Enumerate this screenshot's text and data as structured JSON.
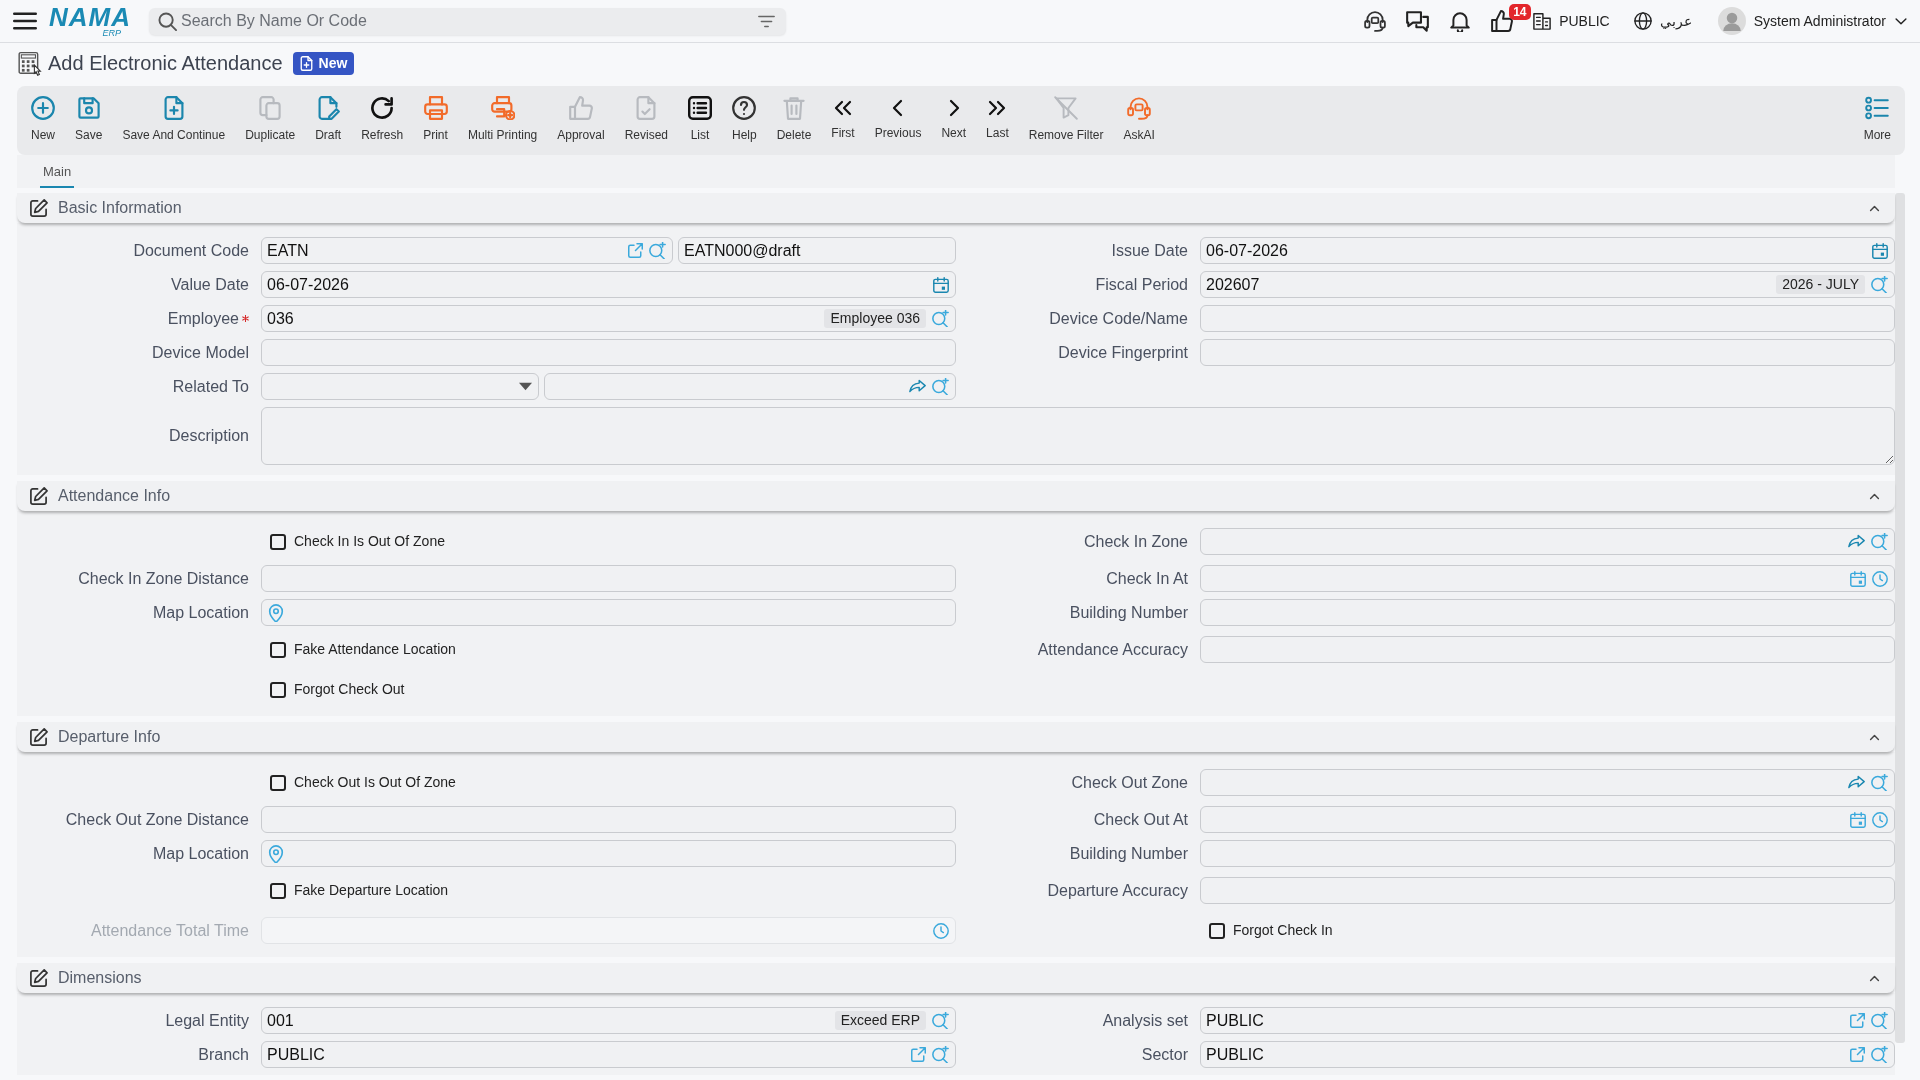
{
  "topbar": {
    "logo": {
      "name": "NAMA",
      "sub": "ERP"
    },
    "search": {
      "placeholder": "Search By Name Or Code"
    },
    "notification_count": "14",
    "company": "PUBLIC",
    "language": "عربي",
    "user": "System Administrator"
  },
  "page": {
    "title": "Add Electronic Attendance",
    "status": "New"
  },
  "toolbar": [
    {
      "label": "New",
      "disabled": false
    },
    {
      "label": "Save",
      "disabled": false
    },
    {
      "label": "Save And Continue",
      "disabled": false
    },
    {
      "label": "Duplicate",
      "disabled": true
    },
    {
      "label": "Draft",
      "disabled": false
    },
    {
      "label": "Refresh",
      "disabled": false
    },
    {
      "label": "Print",
      "disabled": false
    },
    {
      "label": "Multi Printing",
      "disabled": false
    },
    {
      "label": "Approval",
      "disabled": true
    },
    {
      "label": "Revised",
      "disabled": true
    },
    {
      "label": "List",
      "disabled": false
    },
    {
      "label": "Help",
      "disabled": false
    },
    {
      "label": "Delete",
      "disabled": true
    },
    {
      "label": "First",
      "disabled": false
    },
    {
      "label": "Previous",
      "disabled": false
    },
    {
      "label": "Next",
      "disabled": false
    },
    {
      "label": "Last",
      "disabled": false
    },
    {
      "label": "Remove Filter",
      "disabled": true
    },
    {
      "label": "AskAI",
      "disabled": false
    }
  ],
  "toolbar_more": {
    "label": "More"
  },
  "tabs": [
    {
      "label": "Main",
      "selected": true
    }
  ],
  "sections": [
    {
      "title": "Basic Information",
      "expanded": true,
      "rows": [
        {
          "left": {
            "kind": "field",
            "label": "Document Code",
            "required": false,
            "disabled": false,
            "inputs": [
              {
                "kind": "link",
                "value": "EATN"
              },
              {
                "kind": "text",
                "value": "EATN000@draft"
              }
            ]
          },
          "right": {
            "kind": "field",
            "label": "Issue Date",
            "required": false,
            "disabled": false,
            "inputs": [
              {
                "kind": "date",
                "value": "06-07-2026"
              }
            ]
          }
        },
        {
          "left": {
            "kind": "field",
            "label": "Value Date",
            "required": false,
            "disabled": false,
            "inputs": [
              {
                "kind": "date",
                "value": "06-07-2026"
              }
            ]
          },
          "right": {
            "kind": "field",
            "label": "Fiscal Period",
            "required": false,
            "disabled": false,
            "inputs": [
              {
                "kind": "lookup",
                "value": "202607",
                "tag": "2026 - JULY"
              }
            ]
          }
        },
        {
          "left": {
            "kind": "field",
            "label": "Employee",
            "required": true,
            "disabled": false,
            "inputs": [
              {
                "kind": "lookup",
                "value": "036",
                "tag": "Employee 036"
              }
            ]
          },
          "right": {
            "kind": "field",
            "label": "Device Code/Name",
            "required": false,
            "disabled": false,
            "inputs": [
              {
                "kind": "text"
              }
            ]
          }
        },
        {
          "left": {
            "kind": "field",
            "label": "Device Model",
            "required": false,
            "disabled": false,
            "inputs": [
              {
                "kind": "text"
              }
            ]
          },
          "right": {
            "kind": "field",
            "label": "Device Fingerprint",
            "required": false,
            "disabled": false,
            "inputs": [
              {
                "kind": "text"
              }
            ]
          }
        },
        {
          "left": {
            "kind": "field",
            "label": "Related To",
            "required": false,
            "disabled": false,
            "inputs": [
              {
                "kind": "select"
              },
              {
                "kind": "reference"
              }
            ]
          }
        },
        {
          "wide": {
            "kind": "field",
            "label": "Description",
            "required": false,
            "disabled": false,
            "inputs": [
              {
                "kind": "textarea"
              }
            ]
          }
        }
      ]
    },
    {
      "title": "Attendance Info",
      "expanded": true,
      "rows": [
        {
          "left": {
            "kind": "checkbox",
            "label": "Check In Is Out Of Zone",
            "checked": false
          },
          "right": {
            "kind": "field",
            "label": "Check In Zone",
            "required": false,
            "disabled": false,
            "inputs": [
              {
                "kind": "reference"
              }
            ]
          }
        },
        {
          "left": {
            "kind": "field",
            "label": "Check In Zone Distance",
            "required": false,
            "disabled": false,
            "inputs": [
              {
                "kind": "text"
              }
            ]
          },
          "right": {
            "kind": "field",
            "label": "Check In At",
            "required": false,
            "disabled": false,
            "inputs": [
              {
                "kind": "datetime"
              }
            ]
          }
        },
        {
          "left": {
            "kind": "field",
            "label": "Map Location",
            "required": false,
            "disabled": false,
            "inputs": [
              {
                "kind": "location"
              }
            ]
          },
          "right": {
            "kind": "field",
            "label": "Building Number",
            "required": false,
            "disabled": false,
            "inputs": [
              {
                "kind": "text"
              }
            ]
          }
        },
        {
          "left": {
            "kind": "checkbox",
            "label": "Fake Attendance Location",
            "checked": false
          },
          "right": {
            "kind": "field",
            "label": "Attendance Accuracy",
            "required": false,
            "disabled": false,
            "inputs": [
              {
                "kind": "text"
              }
            ]
          }
        },
        {
          "left": {
            "kind": "checkbox",
            "label": "Forgot Check Out",
            "checked": false
          }
        }
      ]
    },
    {
      "title": "Departure Info",
      "expanded": true,
      "rows": [
        {
          "left": {
            "kind": "checkbox",
            "label": "Check Out Is Out Of Zone",
            "checked": false
          },
          "right": {
            "kind": "field",
            "label": "Check Out Zone",
            "required": false,
            "disabled": false,
            "inputs": [
              {
                "kind": "reference"
              }
            ]
          }
        },
        {
          "left": {
            "kind": "field",
            "label": "Check Out Zone Distance",
            "required": false,
            "disabled": false,
            "inputs": [
              {
                "kind": "text"
              }
            ]
          },
          "right": {
            "kind": "field",
            "label": "Check Out At",
            "required": false,
            "disabled": false,
            "inputs": [
              {
                "kind": "datetime"
              }
            ]
          }
        },
        {
          "left": {
            "kind": "field",
            "label": "Map Location",
            "required": false,
            "disabled": false,
            "inputs": [
              {
                "kind": "location"
              }
            ]
          },
          "right": {
            "kind": "field",
            "label": "Building Number",
            "required": false,
            "disabled": false,
            "inputs": [
              {
                "kind": "text"
              }
            ]
          }
        },
        {
          "left": {
            "kind": "checkbox",
            "label": "Fake Departure Location",
            "checked": false
          },
          "right": {
            "kind": "field",
            "label": "Departure Accuracy",
            "required": false,
            "disabled": false,
            "inputs": [
              {
                "kind": "text"
              }
            ]
          }
        },
        {
          "left": {
            "kind": "field",
            "label": "Attendance Total Time",
            "required": false,
            "disabled": true,
            "inputs": [
              {
                "kind": "time"
              }
            ]
          },
          "right": {
            "kind": "checkbox",
            "label": "Forgot Check In",
            "checked": false
          }
        }
      ]
    },
    {
      "title": "Dimensions",
      "expanded": true,
      "rows": [
        {
          "left": {
            "kind": "field",
            "label": "Legal Entity",
            "required": false,
            "disabled": false,
            "inputs": [
              {
                "kind": "lookup",
                "value": "001",
                "tag": "Exceed ERP"
              }
            ]
          },
          "right": {
            "kind": "field",
            "label": "Analysis set",
            "required": false,
            "disabled": false,
            "inputs": [
              {
                "kind": "link",
                "value": "PUBLIC"
              }
            ]
          }
        },
        {
          "left": {
            "kind": "field",
            "label": "Branch",
            "required": false,
            "disabled": false,
            "inputs": [
              {
                "kind": "link",
                "value": "PUBLIC"
              }
            ]
          },
          "right": {
            "kind": "field",
            "label": "Sector",
            "required": false,
            "disabled": false,
            "inputs": [
              {
                "kind": "link",
                "value": "PUBLIC"
              }
            ]
          }
        }
      ]
    }
  ]
}
